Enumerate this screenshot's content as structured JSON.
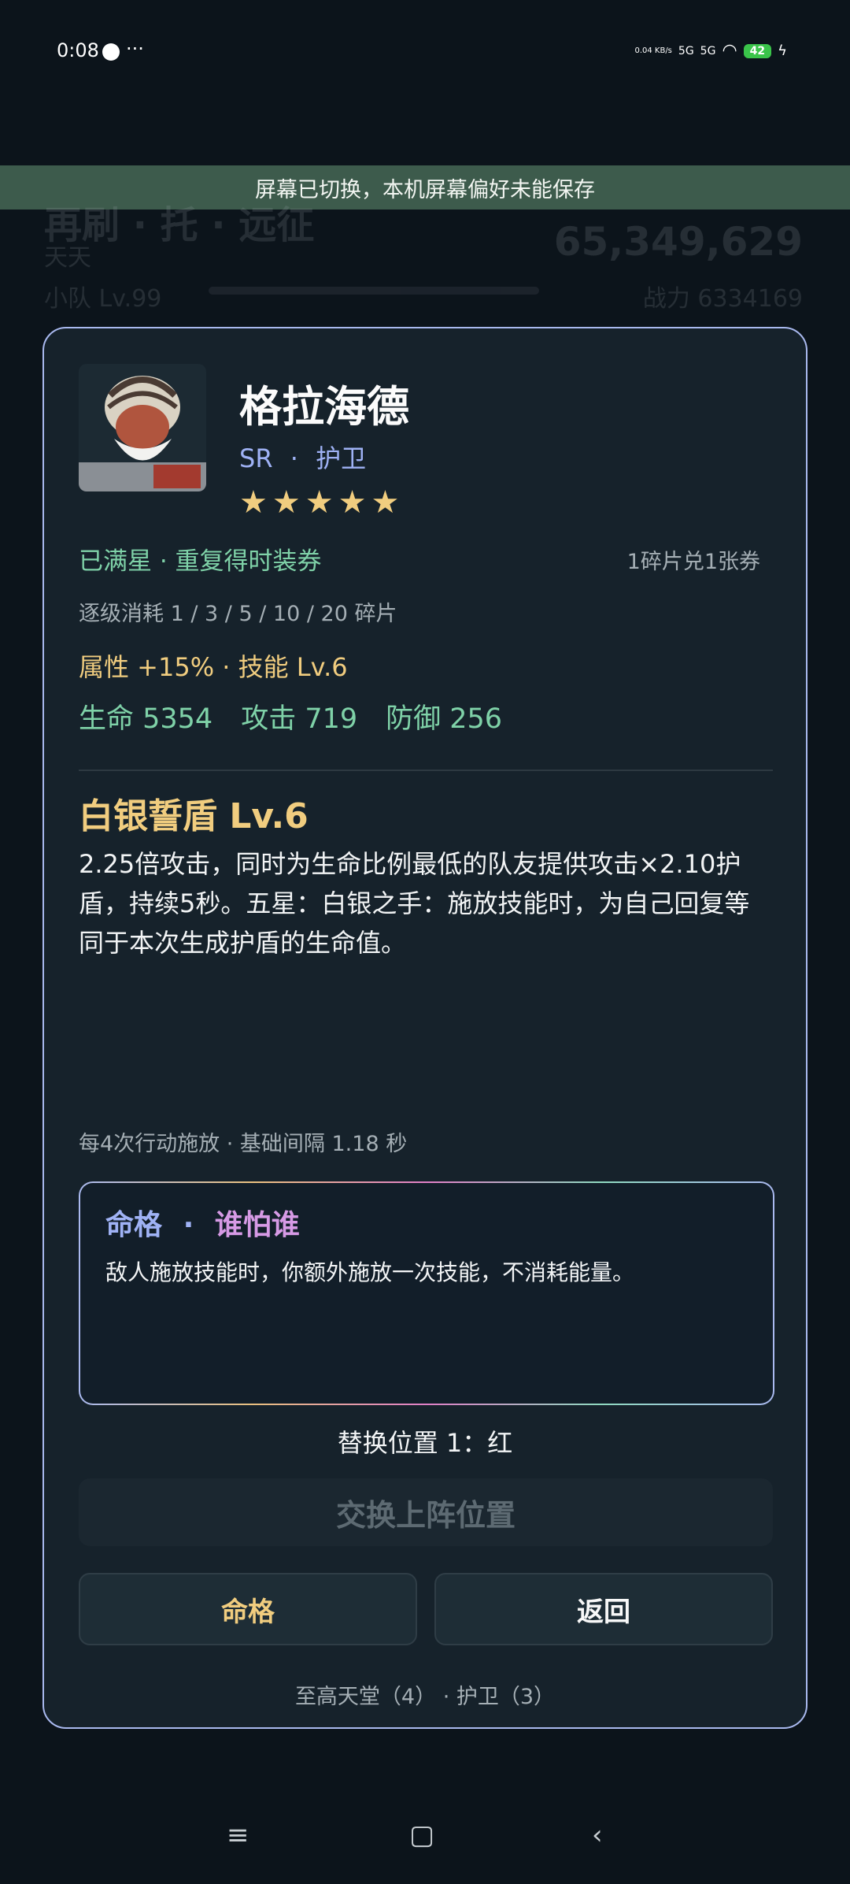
{
  "status_bar": {
    "time": "0:08",
    "dots": "···",
    "net_speed": "0.04\nKB/s",
    "signal_1": "5G",
    "signal_2": "5G",
    "battery": "42"
  },
  "toast": {
    "text": "屏幕已切换，本机屏幕偏好未能保存"
  },
  "background": {
    "title": "再刷 · 托 · 远征",
    "player": "天天",
    "team": "小队 Lv.99",
    "score": "65,349,629",
    "power": "战力 6334169"
  },
  "hero": {
    "name": "格拉海德",
    "rarity": "SR",
    "role": "护卫",
    "separator": "·",
    "stars": [
      "★",
      "★",
      "★",
      "★",
      "★"
    ]
  },
  "progress": {
    "maxed": "已满星 · 重复得时装券",
    "exchange": "1碎片兑1张券",
    "cost": "逐级消耗 1 / 3 / 5 / 10 / 20 碎片",
    "attr": "属性 +15% · 技能 Lv.6"
  },
  "stats": {
    "hp": "生命 5354",
    "atk": "攻击 719",
    "def": "防御 256"
  },
  "skill": {
    "name": "白银誓盾 Lv.6",
    "desc": "2.25倍攻击，同时为生命比例最低的队友提供攻击×2.10护盾，持续5秒。五星：白银之手：施放技能时，为自己回复等同于本次生成护盾的生命值。",
    "cycle": "每4次行动施放 · 基础间隔 1.18 秒"
  },
  "fate": {
    "title": "命格",
    "separator": "·",
    "name": "谁怕谁",
    "desc": "敌人施放技能时，你额外施放一次技能，不消耗能量。"
  },
  "slot": {
    "text": "替换位置 1：红"
  },
  "buttons": {
    "swap": "交换上阵位置",
    "fate": "命格",
    "back": "返回"
  },
  "footer": {
    "text": "至高天堂（4） · 护卫（3）"
  },
  "nav": {
    "menu_icon": "≡",
    "home_icon": "▢",
    "back_icon": "‹"
  },
  "colors": {
    "accent_gold": "#f1cd7f",
    "accent_green": "#7fd2a8",
    "accent_blue": "#9fb2f5",
    "accent_pink": "#d69ae5"
  }
}
